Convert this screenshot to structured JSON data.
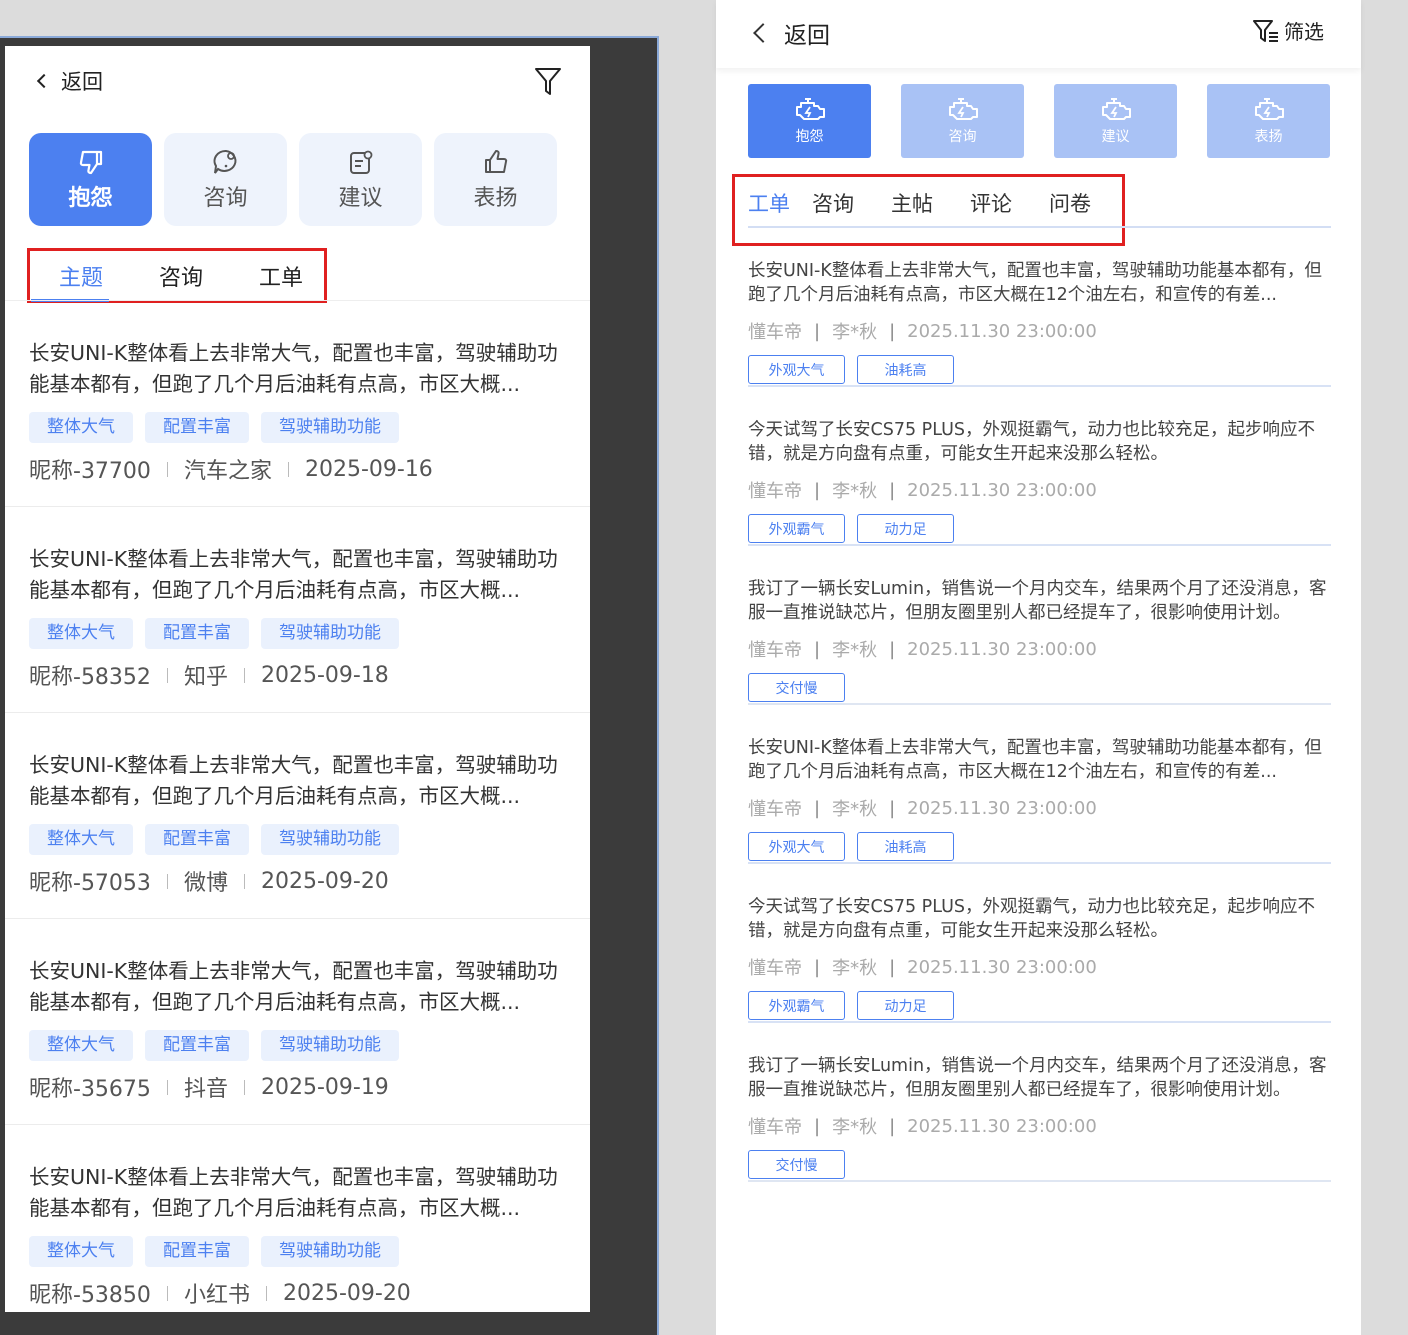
{
  "left": {
    "back_label": "返回",
    "categories": [
      {
        "label": "抱怨",
        "icon": "thumbs-down-icon"
      },
      {
        "label": "咨询",
        "icon": "question-chat-icon"
      },
      {
        "label": "建议",
        "icon": "suggestion-note-icon"
      },
      {
        "label": "表扬",
        "icon": "thumbs-up-icon"
      }
    ],
    "tabs": [
      "主题",
      "咨询",
      "工单"
    ],
    "items": [
      {
        "text": "长安UNI-K整体看上去非常大气，配置也丰富，驾驶辅助功能基本都有，但跑了几个月后油耗有点高，市区大概...",
        "tags": [
          "整体大气",
          "配置丰富",
          "驾驶辅助功能"
        ],
        "nickname": "昵称-37700",
        "source": "汽车之家",
        "date": "2025-09-16"
      },
      {
        "text": "长安UNI-K整体看上去非常大气，配置也丰富，驾驶辅助功能基本都有，但跑了几个月后油耗有点高，市区大概...",
        "tags": [
          "整体大气",
          "配置丰富",
          "驾驶辅助功能"
        ],
        "nickname": "昵称-58352",
        "source": "知乎",
        "date": "2025-09-18"
      },
      {
        "text": "长安UNI-K整体看上去非常大气，配置也丰富，驾驶辅助功能基本都有，但跑了几个月后油耗有点高，市区大概...",
        "tags": [
          "整体大气",
          "配置丰富",
          "驾驶辅助功能"
        ],
        "nickname": "昵称-57053",
        "source": "微博",
        "date": "2025-09-20"
      },
      {
        "text": "长安UNI-K整体看上去非常大气，配置也丰富，驾驶辅助功能基本都有，但跑了几个月后油耗有点高，市区大概...",
        "tags": [
          "整体大气",
          "配置丰富",
          "驾驶辅助功能"
        ],
        "nickname": "昵称-35675",
        "source": "抖音",
        "date": "2025-09-19"
      },
      {
        "text": "长安UNI-K整体看上去非常大气，配置也丰富，驾驶辅助功能基本都有，但跑了几个月后油耗有点高，市区大概...",
        "tags": [
          "整体大气",
          "配置丰富",
          "驾驶辅助功能"
        ],
        "nickname": "昵称-53850",
        "source": "小红书",
        "date": "2025-09-20"
      }
    ]
  },
  "right": {
    "back_label": "返回",
    "filter_label": "筛选",
    "categories": [
      "抱怨",
      "咨询",
      "建议",
      "表扬"
    ],
    "tabs": [
      "工单",
      "咨询",
      "主帖",
      "评论",
      "问卷"
    ],
    "items": [
      {
        "text": "长安UNI-K整体看上去非常大气，配置也丰富，驾驶辅助功能基本都有，但跑了几个月后油耗有点高，市区大概在12个油左右，和宣传的有差...",
        "source": "懂车帝",
        "author": "李*秋",
        "datetime": "2025.11.30 23:00:00",
        "tags": [
          "外观大气",
          "油耗高"
        ]
      },
      {
        "text": "今天试驾了长安CS75 PLUS，外观挺霸气，动力也比较充足，起步响应不错，就是方向盘有点重，可能女生开起来没那么轻松。",
        "source": "懂车帝",
        "author": "李*秋",
        "datetime": "2025.11.30 23:00:00",
        "tags": [
          "外观霸气",
          "动力足"
        ]
      },
      {
        "text": "我订了一辆长安Lumin，销售说一个月内交车，结果两个月了还没消息，客服一直推说缺芯片，但朋友圈里别人都已经提车了，很影响使用计划。",
        "source": "懂车帝",
        "author": "李*秋",
        "datetime": "2025.11.30 23:00:00",
        "tags": [
          "交付慢"
        ]
      },
      {
        "text": "长安UNI-K整体看上去非常大气，配置也丰富，驾驶辅助功能基本都有，但跑了几个月后油耗有点高，市区大概在12个油左右，和宣传的有差...",
        "source": "懂车帝",
        "author": "李*秋",
        "datetime": "2025.11.30 23:00:00",
        "tags": [
          "外观大气",
          "油耗高"
        ]
      },
      {
        "text": "今天试驾了长安CS75 PLUS，外观挺霸气，动力也比较充足，起步响应不错，就是方向盘有点重，可能女生开起来没那么轻松。",
        "source": "懂车帝",
        "author": "李*秋",
        "datetime": "2025.11.30 23:00:00",
        "tags": [
          "外观霸气",
          "动力足"
        ]
      },
      {
        "text": "我订了一辆长安Lumin，销售说一个月内交车，结果两个月了还没消息，客服一直推说缺芯片，但朋友圈里别人都已经提车了，很影响使用计划。",
        "source": "懂车帝",
        "author": "李*秋",
        "datetime": "2025.11.30 23:00:00",
        "tags": [
          "交付慢"
        ]
      }
    ]
  },
  "colors": {
    "accent": "#4c80f0",
    "accent_light": "#a9c2f5",
    "highlight_box": "#e02020"
  }
}
